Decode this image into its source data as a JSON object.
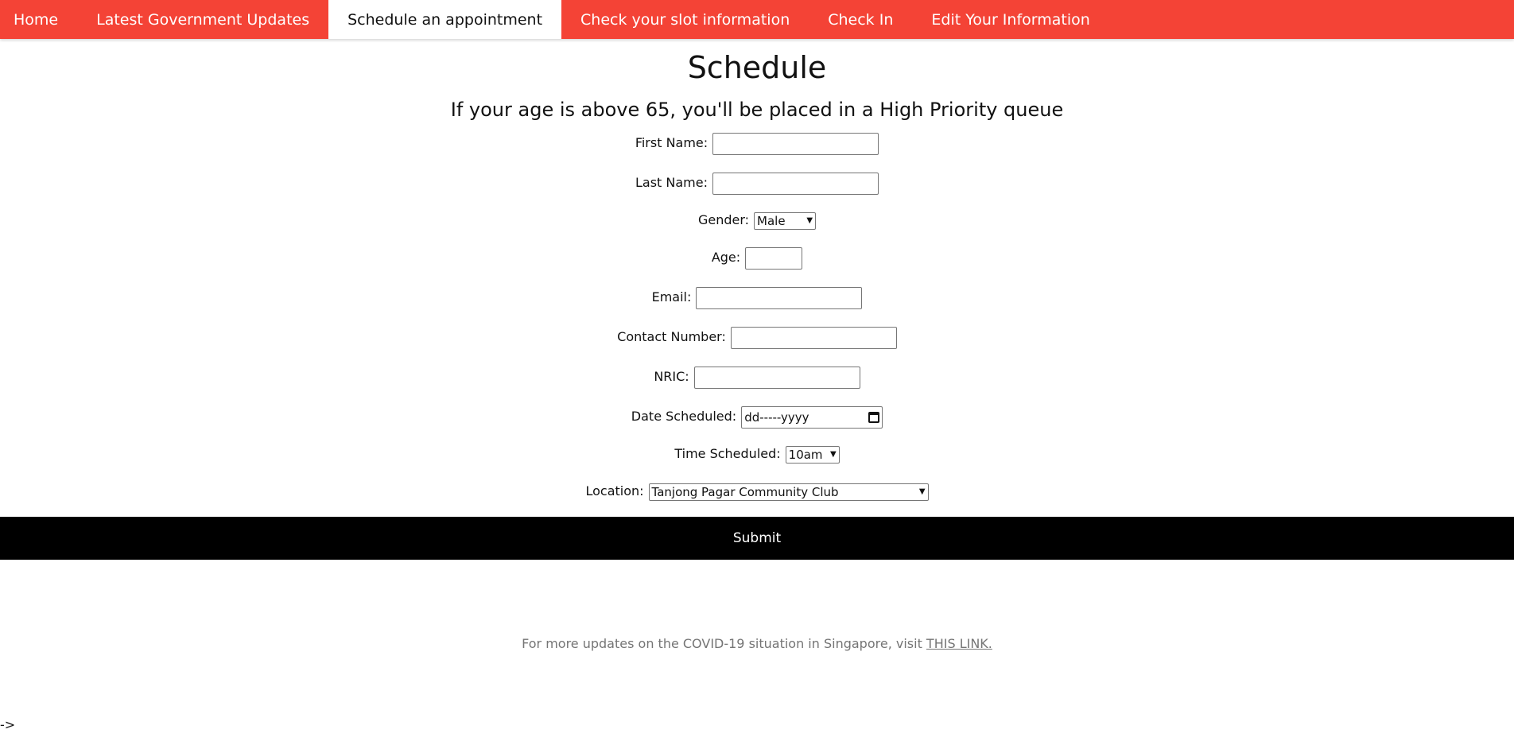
{
  "nav": {
    "items": [
      {
        "label": "Home",
        "active": false
      },
      {
        "label": "Latest Government Updates",
        "active": false
      },
      {
        "label": "Schedule an appointment",
        "active": true
      },
      {
        "label": "Check your slot information",
        "active": false
      },
      {
        "label": "Check In",
        "active": false
      },
      {
        "label": "Edit Your Information",
        "active": false
      }
    ],
    "colors": {
      "background": "#f44336",
      "active_background": "#ffffff"
    }
  },
  "page": {
    "title": "Schedule",
    "subtitle": "If your age is above 65, you'll be placed in a High Priority queue"
  },
  "form": {
    "first_name": {
      "label": "First Name:",
      "value": ""
    },
    "last_name": {
      "label": "Last Name:",
      "value": ""
    },
    "gender": {
      "label": "Gender:",
      "selected": "Male"
    },
    "age": {
      "label": "Age:",
      "value": ""
    },
    "email": {
      "label": "Email:",
      "value": ""
    },
    "contact_number": {
      "label": "Contact Number:",
      "value": ""
    },
    "nric": {
      "label": "NRIC:",
      "value": ""
    },
    "date_scheduled": {
      "label": "Date Scheduled:",
      "placeholder": "dd-----yyyy",
      "icon": "calendar-icon"
    },
    "time_scheduled": {
      "label": "Time Scheduled:",
      "selected": "10am"
    },
    "location": {
      "label": "Location:",
      "selected": "Tanjong Pagar Community Club"
    },
    "submit_label": "Submit"
  },
  "footer": {
    "text": "For more updates on the COVID-19 situation in Singapore, visit ",
    "link_text": "THIS LINK."
  },
  "stray_text": "->"
}
